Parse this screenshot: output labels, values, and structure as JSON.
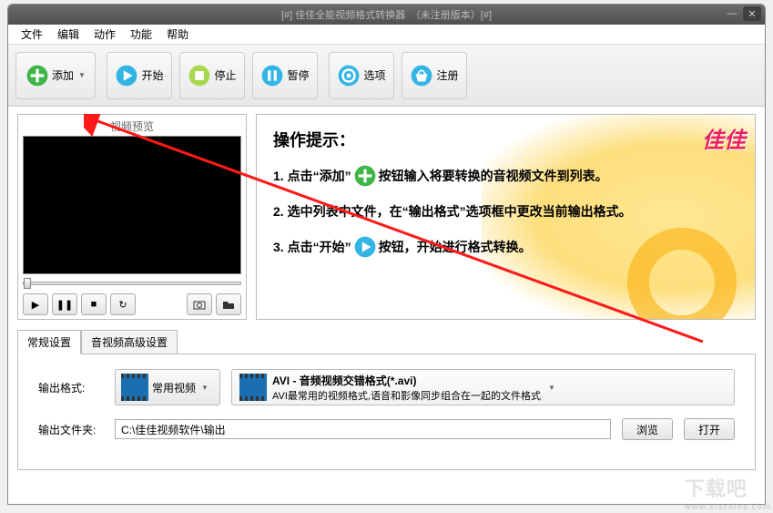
{
  "titlebar": {
    "text": "[#] 佳佳全能视频格式转换器　（未注册版本）[#]"
  },
  "menu": {
    "file": "文件",
    "edit": "编辑",
    "action": "动作",
    "function": "功能",
    "help": "帮助"
  },
  "toolbar": {
    "add": "添加",
    "start": "开始",
    "stop": "停止",
    "pause": "暂停",
    "options": "选项",
    "register": "注册"
  },
  "preview": {
    "title": "视频预览"
  },
  "tips": {
    "logo": "佳佳",
    "title": "操作提示：",
    "line1a": "1. 点击“添加”",
    "line1b": "按钮输入将要转换的音视频文件到列表。",
    "line2": "2. 选中列表中文件，在“输出格式”选项框中更改当前输出格式。",
    "line3a": "3. 点击“开始”",
    "line3b": "按钮，开始进行格式转换。"
  },
  "tabs": {
    "general": "常规设置",
    "advanced": "音视频高级设置"
  },
  "settings": {
    "format_label": "输出格式:",
    "category_label": "常用视频",
    "format_title": "AVI - 音频视频交错格式(*.avi)",
    "format_desc": "AVI最常用的视频格式,语音和影像同步组合在一起的文件格式",
    "folder_label": "输出文件夹:",
    "folder_value": "C:\\佳佳视频软件\\输出",
    "browse": "浏览",
    "open": "打开"
  },
  "watermark": {
    "big": "下载吧",
    "small": "www.xiazaiba.com"
  }
}
